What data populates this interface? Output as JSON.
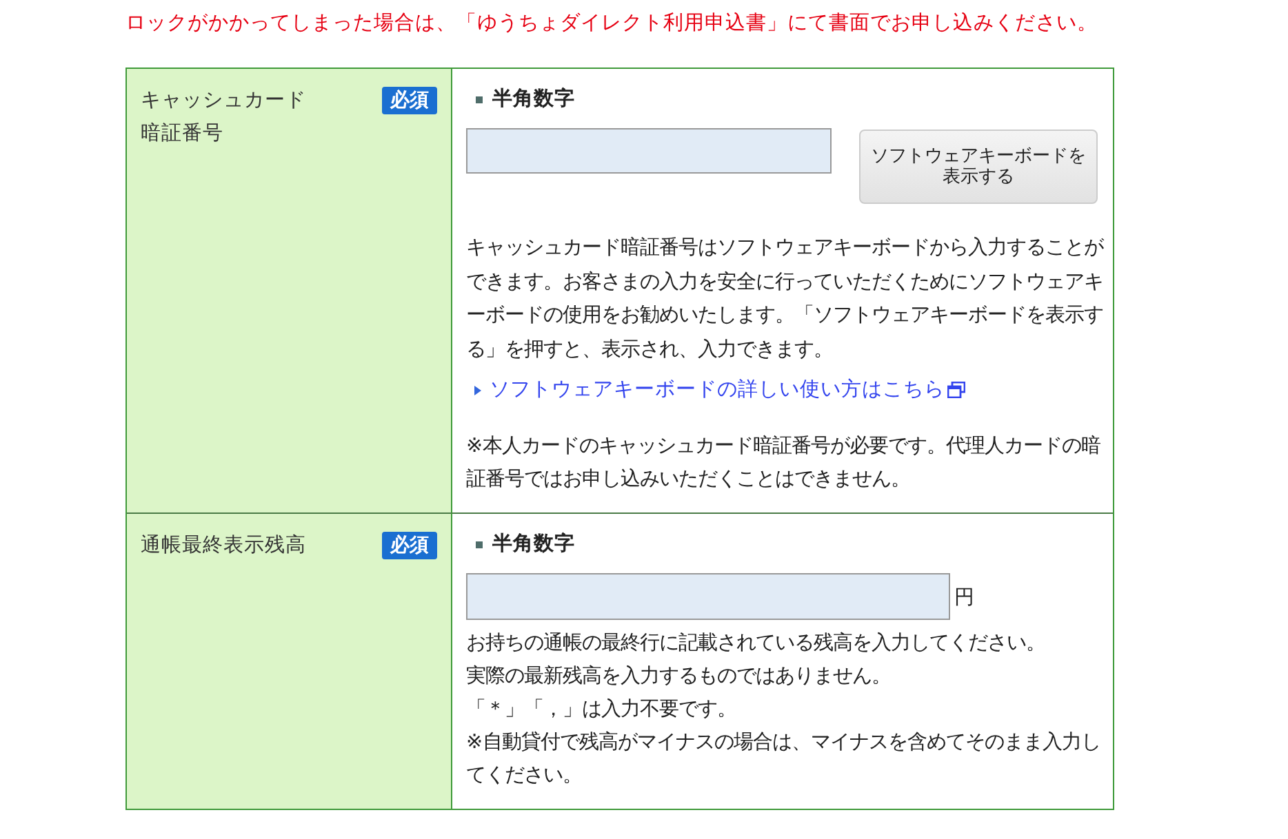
{
  "notice": "ロックがかかってしまった場合は、「ゆうちょダイレクト利用申込書」にて書面でお申し込みください。",
  "fields": [
    {
      "kind": "pin",
      "label": "キャッシュカード暗証番号",
      "badge": "必須",
      "format": "半角数字",
      "button": "ソフトウェアキーボードを表示する",
      "description": "キャッシュカード暗証番号はソフトウェアキーボードから入力することができます。お客さまの入力を安全に行っていただくためにソフトウェアキーボードの使用をお勧めいたします。「ソフトウェアキーボードを表示する」を押すと、表示され、入力できます。",
      "link": "ソフトウェアキーボードの詳しい使い方はこちら",
      "notes": [
        "※本人カードのキャッシュカード暗証番号が必要です。代理人カードの暗証番号ではお申し込みいただくことはできません。"
      ]
    },
    {
      "kind": "amount",
      "label": "通帳最終表示残高",
      "badge": "必須",
      "format": "半角数字",
      "unit": "円",
      "notes": [
        "お持ちの通帳の最終行に記載されている残高を入力してください。",
        "実際の最新残高を入力するものではありません。",
        "「＊」「，」は入力不要です。",
        "※自動貸付で残高がマイナスの場合は、マイナスを含めてそのまま入力してください。"
      ]
    }
  ]
}
